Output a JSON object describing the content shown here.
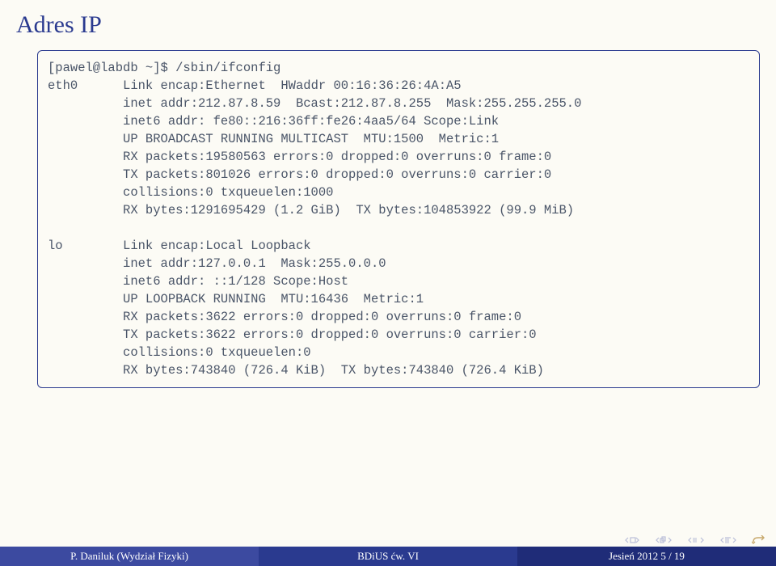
{
  "title": "Adres IP",
  "terminal": {
    "prompt": "[pawel@labdb ~]$ /sbin/ifconfig",
    "eth0": {
      "label": "eth0",
      "l1": "Link encap:Ethernet  HWaddr 00:16:36:26:4A:A5",
      "l2": "inet addr:212.87.8.59  Bcast:212.87.8.255  Mask:255.255.255.0",
      "l3": "inet6 addr: fe80::216:36ff:fe26:4aa5/64 Scope:Link",
      "l4": "UP BROADCAST RUNNING MULTICAST  MTU:1500  Metric:1",
      "l5": "RX packets:19580563 errors:0 dropped:0 overruns:0 frame:0",
      "l6": "TX packets:801026 errors:0 dropped:0 overruns:0 carrier:0",
      "l7": "collisions:0 txqueuelen:1000",
      "l8": "RX bytes:1291695429 (1.2 GiB)  TX bytes:104853922 (99.9 MiB)"
    },
    "lo": {
      "label": "lo",
      "l1": "Link encap:Local Loopback",
      "l2": "inet addr:127.0.0.1  Mask:255.0.0.0",
      "l3": "inet6 addr: ::1/128 Scope:Host",
      "l4": "UP LOOPBACK RUNNING  MTU:16436  Metric:1",
      "l5": "RX packets:3622 errors:0 dropped:0 overruns:0 frame:0",
      "l6": "TX packets:3622 errors:0 dropped:0 overruns:0 carrier:0",
      "l7": "collisions:0 txqueuelen:0",
      "l8": "RX bytes:743840 (726.4 KiB)  TX bytes:743840 (726.4 KiB)"
    }
  },
  "footer": {
    "left": "P. Daniluk (Wydział Fizyki)",
    "center": "BDiUS ćw. VI",
    "right": "Jesień 2012    5 / 19"
  }
}
